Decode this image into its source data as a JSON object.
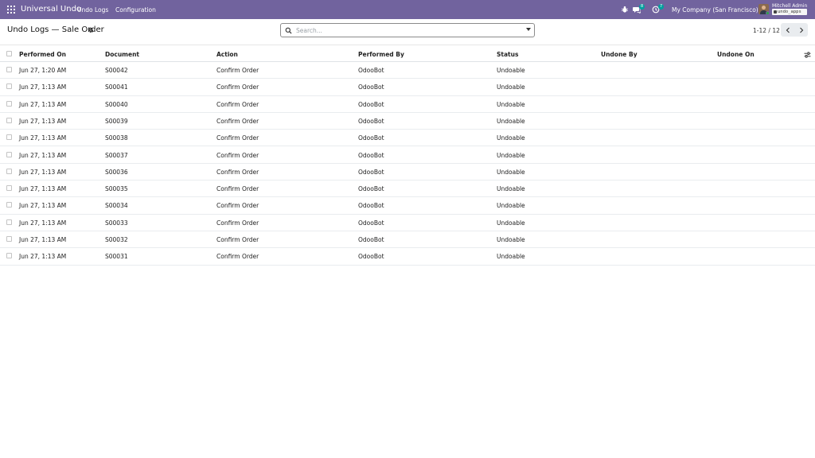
{
  "navbar": {
    "app_name": "Universal Undo",
    "menu": [
      "Undo Logs",
      "Configuration"
    ],
    "bug_icon": "bug-icon",
    "messages_count": "8",
    "activities_count": "7",
    "company": "My Company (San Francisco)",
    "user_name": "Mitchell Admin",
    "database": "undo_apps",
    "color": "#71639e"
  },
  "control_panel": {
    "breadcrumb": "Undo Logs — Sale Order",
    "search_placeholder": "Search...",
    "pager_value": "1-12 / 12"
  },
  "table": {
    "columns": [
      "Performed On",
      "Document",
      "Action",
      "Performed By",
      "Status",
      "Undone By",
      "Undone On"
    ],
    "rows": [
      [
        "Jun 27, 1:20 AM",
        "S00042",
        "Confirm Order",
        "OdooBot",
        "Undoable",
        "",
        ""
      ],
      [
        "Jun 27, 1:13 AM",
        "S00041",
        "Confirm Order",
        "OdooBot",
        "Undoable",
        "",
        ""
      ],
      [
        "Jun 27, 1:13 AM",
        "S00040",
        "Confirm Order",
        "OdooBot",
        "Undoable",
        "",
        ""
      ],
      [
        "Jun 27, 1:13 AM",
        "S00039",
        "Confirm Order",
        "OdooBot",
        "Undoable",
        "",
        ""
      ],
      [
        "Jun 27, 1:13 AM",
        "S00038",
        "Confirm Order",
        "OdooBot",
        "Undoable",
        "",
        ""
      ],
      [
        "Jun 27, 1:13 AM",
        "S00037",
        "Confirm Order",
        "OdooBot",
        "Undoable",
        "",
        ""
      ],
      [
        "Jun 27, 1:13 AM",
        "S00036",
        "Confirm Order",
        "OdooBot",
        "Undoable",
        "",
        ""
      ],
      [
        "Jun 27, 1:13 AM",
        "S00035",
        "Confirm Order",
        "OdooBot",
        "Undoable",
        "",
        ""
      ],
      [
        "Jun 27, 1:13 AM",
        "S00034",
        "Confirm Order",
        "OdooBot",
        "Undoable",
        "",
        ""
      ],
      [
        "Jun 27, 1:13 AM",
        "S00033",
        "Confirm Order",
        "OdooBot",
        "Undoable",
        "",
        ""
      ],
      [
        "Jun 27, 1:13 AM",
        "S00032",
        "Confirm Order",
        "OdooBot",
        "Undoable",
        "",
        ""
      ],
      [
        "Jun 27, 1:13 AM",
        "S00031",
        "Confirm Order",
        "OdooBot",
        "Undoable",
        "",
        ""
      ]
    ]
  }
}
